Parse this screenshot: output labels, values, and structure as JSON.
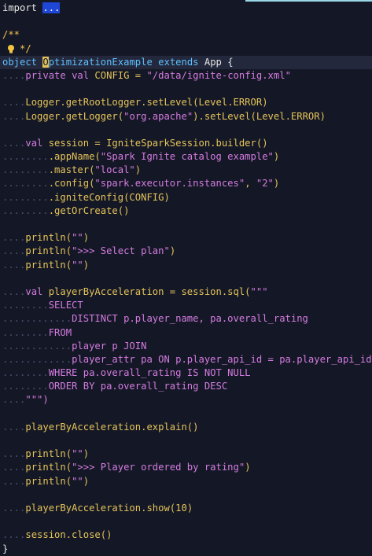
{
  "editor": {
    "lines": [
      [
        {
          "t": "import ",
          "c": "t-default"
        },
        {
          "t": "...",
          "c": "t-sel"
        }
      ],
      [],
      [
        {
          "t": "/**",
          "c": "t-comment"
        }
      ],
      [
        {
          "t": "   */",
          "c": "t-comment",
          "bulb": true
        }
      ],
      [
        {
          "t": "object ",
          "c": "t-kw-obj"
        },
        {
          "t": "O",
          "c": "t-cursor"
        },
        {
          "t": "ptimizationExample",
          "c": "t-kw-obj"
        },
        {
          "t": " ",
          "c": "t-default"
        },
        {
          "t": "extends",
          "c": "t-kw-obj"
        },
        {
          "t": " App {",
          "c": "t-default"
        }
      ],
      [
        {
          "t": "....",
          "c": "t-space"
        },
        {
          "t": "private",
          "c": "t-kw"
        },
        {
          "t": " ",
          "c": "t-default"
        },
        {
          "t": "val",
          "c": "t-kw"
        },
        {
          "t": " CONFIG = ",
          "c": "t-const"
        },
        {
          "t": "\"/data/ignite-config.xml\"",
          "c": "t-str"
        }
      ],
      [],
      [
        {
          "t": "....",
          "c": "t-space"
        },
        {
          "t": "Logger.getRootLogger.setLevel(Level.ERROR)",
          "c": "t-const"
        }
      ],
      [
        {
          "t": "....",
          "c": "t-space"
        },
        {
          "t": "Logger.getLogger(",
          "c": "t-const"
        },
        {
          "t": "\"org.apache\"",
          "c": "t-str"
        },
        {
          "t": ").setLevel(Level.ERROR)",
          "c": "t-const"
        }
      ],
      [],
      [
        {
          "t": "....",
          "c": "t-space"
        },
        {
          "t": "val",
          "c": "t-kw"
        },
        {
          "t": " session = IgniteSparkSession.builder()",
          "c": "t-const"
        }
      ],
      [
        {
          "t": "........",
          "c": "t-space"
        },
        {
          "t": ".appName(",
          "c": "t-const"
        },
        {
          "t": "\"Spark Ignite catalog example\"",
          "c": "t-str"
        },
        {
          "t": ")",
          "c": "t-const"
        }
      ],
      [
        {
          "t": "........",
          "c": "t-space"
        },
        {
          "t": ".master(",
          "c": "t-const"
        },
        {
          "t": "\"local\"",
          "c": "t-str"
        },
        {
          "t": ")",
          "c": "t-const"
        }
      ],
      [
        {
          "t": "........",
          "c": "t-space"
        },
        {
          "t": ".config(",
          "c": "t-const"
        },
        {
          "t": "\"spark.executor.instances\"",
          "c": "t-str"
        },
        {
          "t": ", ",
          "c": "t-const"
        },
        {
          "t": "\"2\"",
          "c": "t-str"
        },
        {
          "t": ")",
          "c": "t-const"
        }
      ],
      [
        {
          "t": "........",
          "c": "t-space"
        },
        {
          "t": ".igniteConfig(CONFIG)",
          "c": "t-const"
        }
      ],
      [
        {
          "t": "........",
          "c": "t-space"
        },
        {
          "t": ".getOrCreate()",
          "c": "t-const"
        }
      ],
      [],
      [
        {
          "t": "....",
          "c": "t-space"
        },
        {
          "t": "println(",
          "c": "t-const"
        },
        {
          "t": "\"\"",
          "c": "t-str"
        },
        {
          "t": ")",
          "c": "t-const"
        }
      ],
      [
        {
          "t": "....",
          "c": "t-space"
        },
        {
          "t": "println(",
          "c": "t-const"
        },
        {
          "t": "\">>> Select plan\"",
          "c": "t-str"
        },
        {
          "t": ")",
          "c": "t-const"
        }
      ],
      [
        {
          "t": "....",
          "c": "t-space"
        },
        {
          "t": "println(",
          "c": "t-const"
        },
        {
          "t": "\"\"",
          "c": "t-str"
        },
        {
          "t": ")",
          "c": "t-const"
        }
      ],
      [],
      [
        {
          "t": "....",
          "c": "t-space"
        },
        {
          "t": "val",
          "c": "t-kw"
        },
        {
          "t": " playerByAcceleration = session.sql(",
          "c": "t-const"
        },
        {
          "t": "\"\"\"",
          "c": "t-str"
        }
      ],
      [
        {
          "t": "........",
          "c": "t-space"
        },
        {
          "t": "SELECT",
          "c": "t-sql"
        }
      ],
      [
        {
          "t": "............",
          "c": "t-space"
        },
        {
          "t": "DISTINCT p.player_name, pa.overall_rating",
          "c": "t-sql"
        }
      ],
      [
        {
          "t": "........",
          "c": "t-space"
        },
        {
          "t": "FROM",
          "c": "t-sql"
        }
      ],
      [
        {
          "t": "............",
          "c": "t-space"
        },
        {
          "t": "player p JOIN",
          "c": "t-sql"
        }
      ],
      [
        {
          "t": "............",
          "c": "t-space"
        },
        {
          "t": "player_attr pa ON p.player_api_id = pa.player_api_id",
          "c": "t-sql"
        }
      ],
      [
        {
          "t": "........",
          "c": "t-space"
        },
        {
          "t": "WHERE pa.overall_rating IS NOT NULL",
          "c": "t-sql"
        }
      ],
      [
        {
          "t": "........",
          "c": "t-space"
        },
        {
          "t": "ORDER BY pa.overall_rating DESC",
          "c": "t-sql"
        }
      ],
      [
        {
          "t": "....",
          "c": "t-space"
        },
        {
          "t": "\"\"\")",
          "c": "t-str"
        }
      ],
      [],
      [
        {
          "t": "....",
          "c": "t-space"
        },
        {
          "t": "playerByAcceleration.explain()",
          "c": "t-const"
        }
      ],
      [],
      [
        {
          "t": "....",
          "c": "t-space"
        },
        {
          "t": "println(",
          "c": "t-const"
        },
        {
          "t": "\"\"",
          "c": "t-str"
        },
        {
          "t": ")",
          "c": "t-const"
        }
      ],
      [
        {
          "t": "....",
          "c": "t-space"
        },
        {
          "t": "println(",
          "c": "t-const"
        },
        {
          "t": "\">>> Player ordered by rating\"",
          "c": "t-str"
        },
        {
          "t": ")",
          "c": "t-const"
        }
      ],
      [
        {
          "t": "....",
          "c": "t-space"
        },
        {
          "t": "println(",
          "c": "t-const"
        },
        {
          "t": "\"\"",
          "c": "t-str"
        },
        {
          "t": ")",
          "c": "t-const"
        }
      ],
      [],
      [
        {
          "t": "....",
          "c": "t-space"
        },
        {
          "t": "playerByAcceleration.show(",
          "c": "t-const"
        },
        {
          "t": "10",
          "c": "t-lit"
        },
        {
          "t": ")",
          "c": "t-const"
        }
      ],
      [],
      [
        {
          "t": "....",
          "c": "t-space"
        },
        {
          "t": "session.close()",
          "c": "t-const"
        }
      ],
      [
        {
          "t": "}",
          "c": "t-default"
        }
      ]
    ],
    "current_line": 4,
    "bulb_icon": "lightbulb-icon",
    "colors": {
      "background": "#141826",
      "keyword": "#5ec0ff",
      "string": "#d47be0",
      "identifier": "#e5c35a",
      "selection": "#1f47d6"
    }
  }
}
